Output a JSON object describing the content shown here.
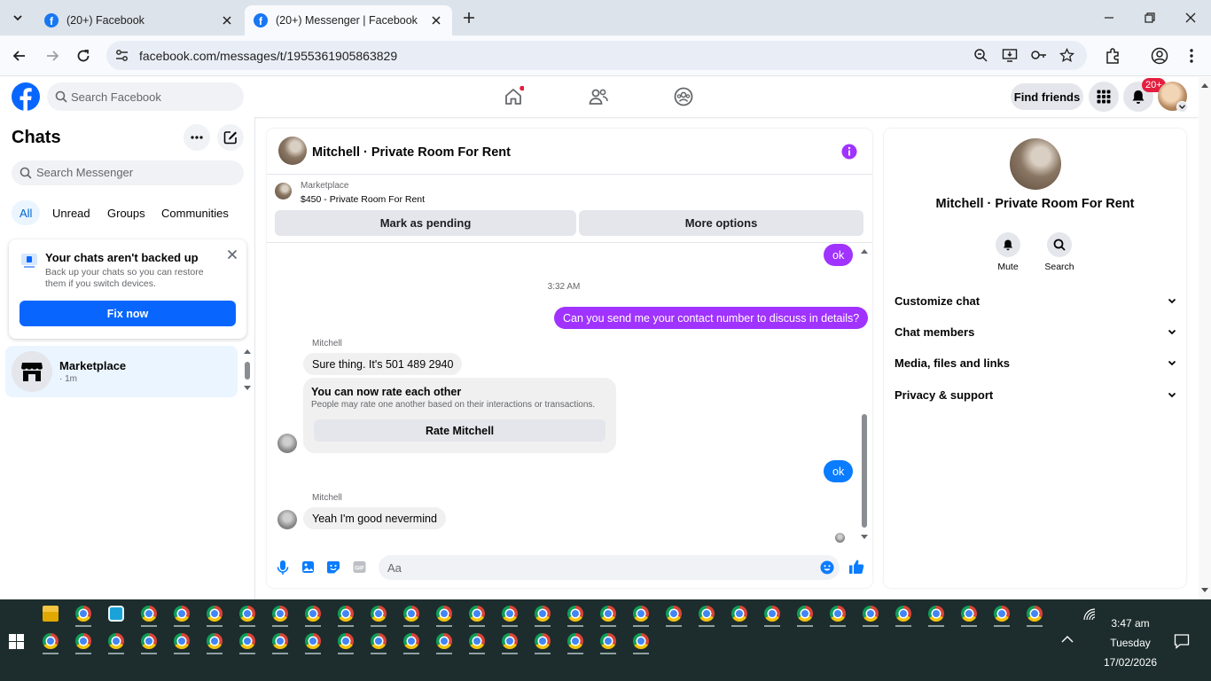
{
  "browser": {
    "tabs": [
      {
        "title": "(20+) Facebook",
        "active": false
      },
      {
        "title": "(20+) Messenger | Facebook",
        "active": true
      }
    ],
    "url": "facebook.com/messages/t/1955361905863829"
  },
  "header": {
    "search_placeholder": "Search Facebook",
    "find_friends": "Find friends",
    "notification_count": "20+"
  },
  "sidebar": {
    "title": "Chats",
    "search_placeholder": "Search Messenger",
    "filters": [
      "All",
      "Unread",
      "Groups",
      "Communities"
    ],
    "backup": {
      "title": "Your chats aren't backed up",
      "description": "Back up your chats so you can restore them if you switch devices.",
      "button": "Fix now"
    },
    "chats": [
      {
        "name": "Marketplace",
        "subtitle": "· 1m"
      }
    ]
  },
  "conversation": {
    "title": "Mitchell · Private Room For Rent",
    "marketplace": {
      "label": "Marketplace",
      "listing": "$450 - Private Room For Rent",
      "pending_button": "Mark as pending",
      "more_button": "More options"
    },
    "messages": {
      "m1": "ok",
      "timestamp": "3:32 AM",
      "m2": "Can you send me your contact number to discuss in details?",
      "sender1": "Mitchell",
      "m3": "Sure thing. It's 501 489 2940",
      "rate_title": "You can now rate each other",
      "rate_desc": "People may rate one another based on their interactions or transactions.",
      "rate_button": "Rate Mitchell",
      "m4": "ok",
      "sender2": "Mitchell",
      "m5": "Yeah I'm good nevermind"
    },
    "composer_placeholder": "Aa"
  },
  "details": {
    "name": "Mitchell · Private Room For Rent",
    "actions": [
      "Mute",
      "Search"
    ],
    "sections": [
      "Customize chat",
      "Chat members",
      "Media, files and links",
      "Privacy & support"
    ]
  },
  "taskbar": {
    "time": "3:47 am",
    "day": "Tuesday",
    "date": "17/02/2026"
  },
  "colors": {
    "facebook_blue": "#0866ff",
    "outgoing_purple": "#a033ff",
    "outgoing_blue": "#0a7cff"
  }
}
